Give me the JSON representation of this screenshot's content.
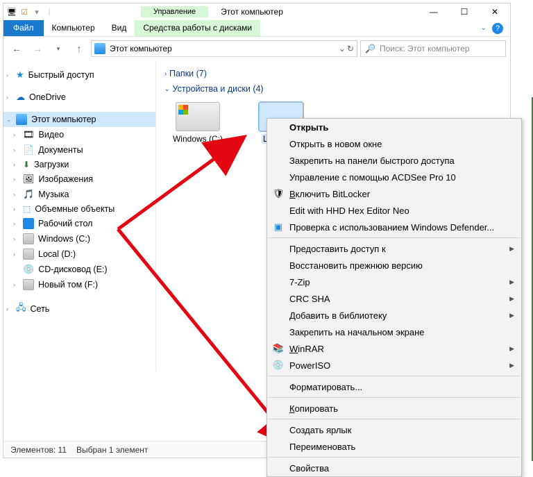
{
  "titlebar": {
    "context_tab": "Управление",
    "title": "Этот компьютер"
  },
  "ribbon": {
    "file": "Файл",
    "tabs": [
      "Компьютер",
      "Вид"
    ],
    "context": "Средства работы с дисками"
  },
  "address": {
    "location": "Этот компьютер",
    "search_placeholder": "Поиск: Этот компьютер"
  },
  "sidebar": {
    "quick": "Быстрый доступ",
    "onedrive": "OneDrive",
    "thispc": "Этот компьютер",
    "children": [
      {
        "label": "Видео"
      },
      {
        "label": "Документы"
      },
      {
        "label": "Загрузки"
      },
      {
        "label": "Изображения"
      },
      {
        "label": "Музыка"
      },
      {
        "label": "Объемные объекты"
      },
      {
        "label": "Рабочий стол"
      },
      {
        "label": "Windows (C:)"
      },
      {
        "label": "Local (D:)"
      },
      {
        "label": "CD-дисковод (E:)"
      },
      {
        "label": "Новый том (F:)"
      }
    ],
    "network": "Сеть"
  },
  "content": {
    "folders_header": "Папки (7)",
    "drives_header": "Устройства и диски (4)",
    "drive_c": "Windows (C:)",
    "drive_d": "Local (D:)"
  },
  "statusbar": {
    "count": "Элементов: 11",
    "selection": "Выбран 1 элемент"
  },
  "context_menu": {
    "open": "Открыть",
    "open_new": "Открыть в новом окне",
    "pin_quick": "Закрепить на панели быстрого доступа",
    "acdsee": "Управление с помощью ACDSee Pro 10",
    "bitlocker": "Включить BitLocker",
    "hexeditor": "Edit with HHD Hex Editor Neo",
    "defender": "Проверка с использованием Windows Defender...",
    "share": "Предоставить доступ к",
    "restore": "Восстановить прежнюю версию",
    "7zip": "7-Zip",
    "crcsha": "CRC SHA",
    "library": "Добавить в библиотеку",
    "pin_start": "Закрепить на начальном экране",
    "winrar": "WinRAR",
    "poweriso": "PowerISO",
    "format": "Форматировать...",
    "copy": "Копировать",
    "shortcut": "Создать ярлык",
    "rename": "Переименовать",
    "properties": "Свойства"
  }
}
